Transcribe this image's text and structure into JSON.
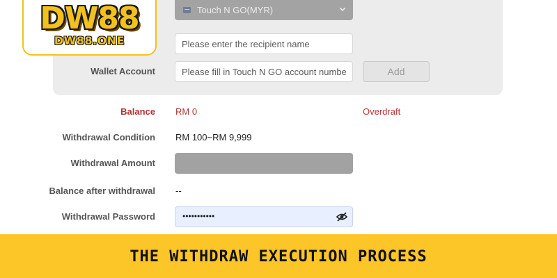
{
  "logo": {
    "main": "DW88",
    "sub": "DW88.ONE"
  },
  "wallet_card": {
    "bank_select": {
      "selected": "Touch N GO(MYR)"
    },
    "recipient_input": {
      "placeholder": "Please enter the recipient name",
      "value": ""
    },
    "wallet_account": {
      "label": "Wallet Account",
      "placeholder": "Please fill in Touch N GO account number",
      "value": ""
    },
    "add_button": "Add"
  },
  "balance": {
    "label": "Balance",
    "value": "RM 0",
    "overdraft": "Overdraft"
  },
  "withdrawal_condition": {
    "label": "Withdrawal Condition",
    "value": "RM 100~RM 9,999"
  },
  "withdrawal_amount": {
    "label": "Withdrawal Amount",
    "value": ""
  },
  "balance_after": {
    "label": "Balance after withdrawal",
    "value": "--"
  },
  "withdrawal_password": {
    "label": "Withdrawal Password",
    "masked_value": "•••••••••••"
  },
  "banner": {
    "title": "THE WITHDRAW EXECUTION PROCESS"
  },
  "colors": {
    "accent_yellow": "#fcc528",
    "balance_red": "#b03434",
    "card_gray": "#ececec"
  },
  "icons": {
    "wallet": "wallet-icon",
    "dropdown": "chevron-down-icon",
    "password_toggle": "eye-slash-icon"
  }
}
